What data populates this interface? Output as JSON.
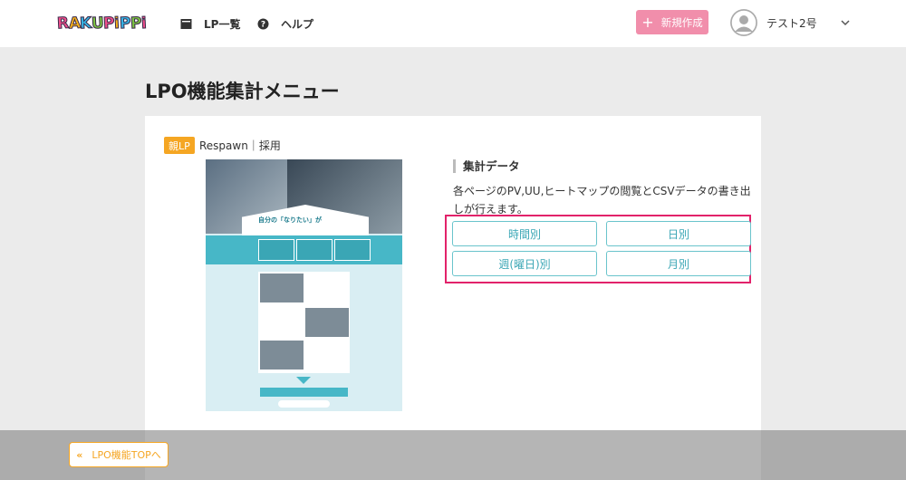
{
  "header": {
    "logo": "RAKUPIPPI",
    "nav": [
      {
        "icon": "document-icon",
        "label": "LP一覧"
      },
      {
        "icon": "help-icon",
        "label": "ヘルプ"
      }
    ],
    "new_button": {
      "icon": "plus-icon",
      "label": "新規作成"
    },
    "user": {
      "name": "テスト2号"
    }
  },
  "page": {
    "title": "LPO機能集計メニュー"
  },
  "card": {
    "badge": "親LP",
    "lp_name": "Respawn｜採用",
    "thumbnail": {
      "headline": "自分の「なりたい」が"
    },
    "section_title": "集計データ",
    "description": "各ページのPV,UU,ヒートマップの閲覧とCSVデータの書き出しが行えます。",
    "buttons": [
      {
        "label": "時間別"
      },
      {
        "label": "日別"
      },
      {
        "label": "週(曜日)別"
      },
      {
        "label": "月別"
      }
    ]
  },
  "footer": {
    "back_label": "LPO機能TOPへ",
    "back_icon": "double-chevron-left-icon"
  },
  "colors": {
    "accent_pink": "#f18eab",
    "badge_orange": "#f5a623",
    "button_teal": "#3aa6b5",
    "highlight_red": "#e2226a"
  }
}
